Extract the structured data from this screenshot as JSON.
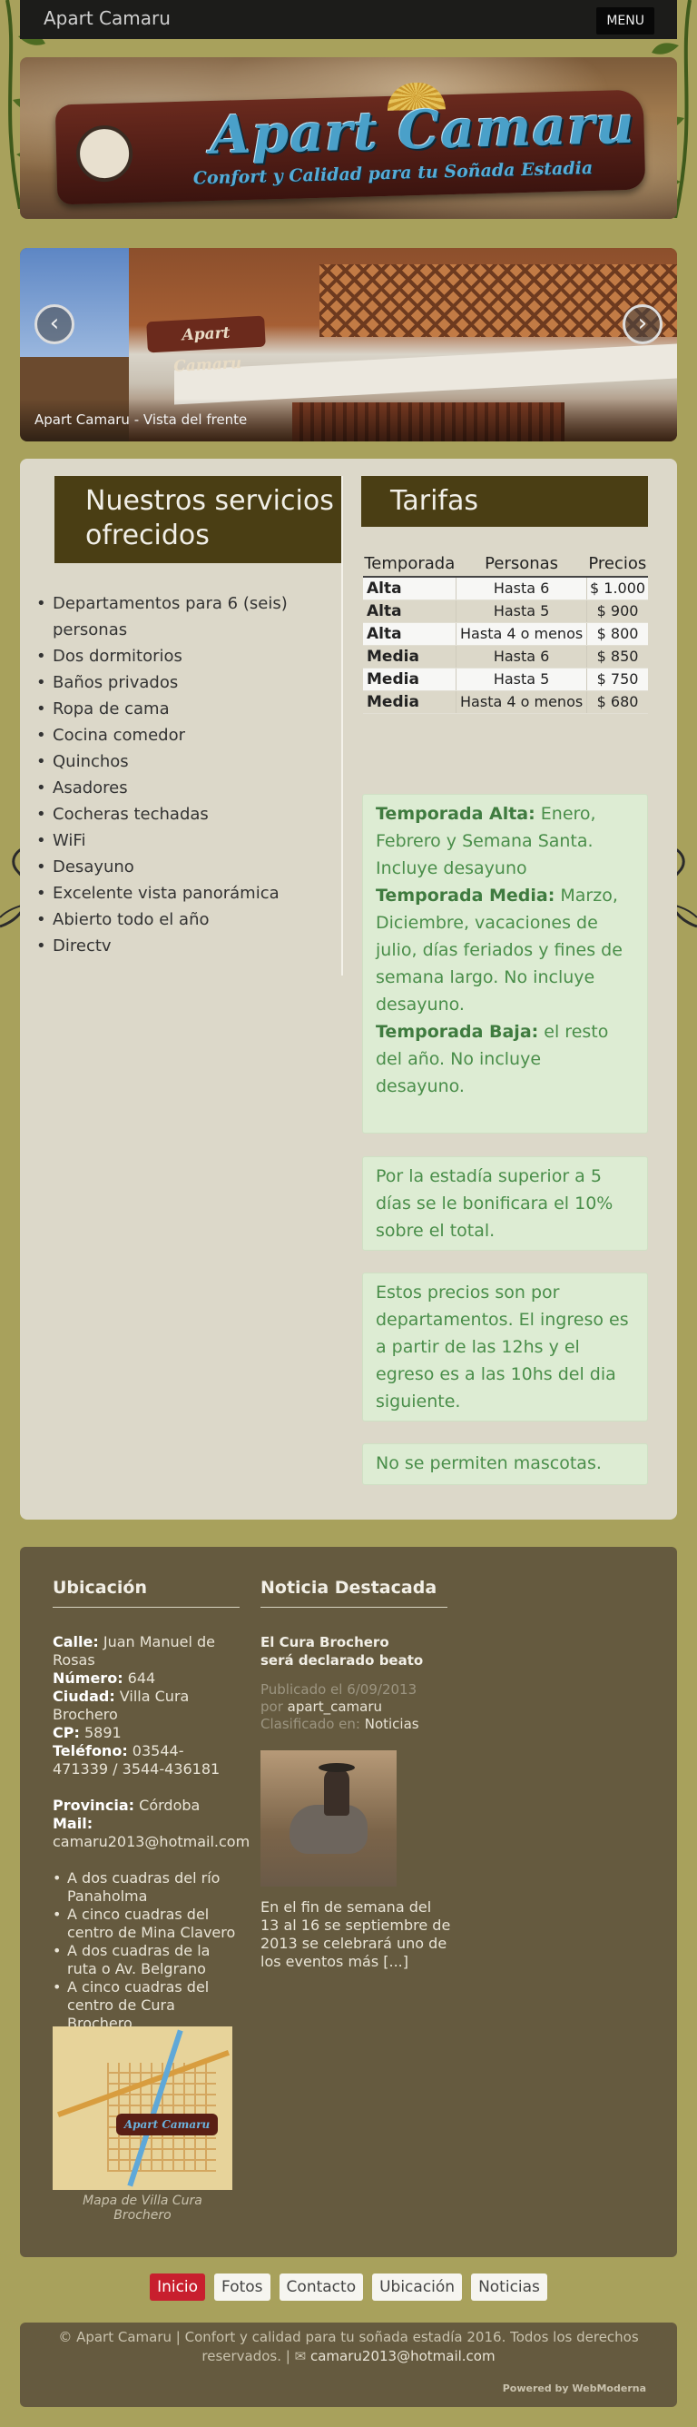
{
  "header": {
    "site_title": "Apart Camaru",
    "menu_label": "MENU"
  },
  "banner": {
    "sign_title": "Apart Camaru",
    "sign_subtitle": "Confort y Calidad para tu Soñada Estadia"
  },
  "slider": {
    "caption": "Apart Camaru - Vista del frente",
    "prev_icon": "chevron-left-icon",
    "next_icon": "chevron-right-icon",
    "sign_text": "Apart Camaru"
  },
  "services": {
    "heading": "Nuestros servicios ofrecidos",
    "items": [
      "Departamentos para 6 (seis) personas",
      "Dos dormitorios",
      "Baños privados",
      "Ropa de cama",
      "Cocina comedor",
      "Quinchos",
      "Asadores",
      "Cocheras techadas",
      "WiFi",
      "Desayuno",
      "Excelente vista panorámica",
      "Abierto todo el año",
      "Directv"
    ]
  },
  "tarifas": {
    "heading": "Tarifas",
    "columns": [
      "Temporada",
      "Personas",
      "Precios"
    ],
    "rows": [
      {
        "temporada": "Alta",
        "personas": "Hasta 6",
        "precio": "$ 1.000"
      },
      {
        "temporada": "Alta",
        "personas": "Hasta 5",
        "precio": "$ 900"
      },
      {
        "temporada": "Alta",
        "personas": "Hasta 4 o menos",
        "precio": "$ 800"
      },
      {
        "temporada": "Media",
        "personas": "Hasta 6",
        "precio": "$ 850"
      },
      {
        "temporada": "Media",
        "personas": "Hasta 5",
        "precio": "$ 750"
      },
      {
        "temporada": "Media",
        "personas": "Hasta 4 o menos",
        "precio": "$ 680"
      }
    ],
    "seasons_note": {
      "alta_label": "Temporada Alta:",
      "alta_text": " Enero, Febrero y Semana Santa. Incluye desayuno",
      "media_label": "Temporada Media:",
      "media_text": " Marzo, Diciembre, vacaciones de julio, días feriados y fines de semana largo. No incluye desayuno.",
      "baja_label": "Temporada Baja:",
      "baja_text": " el resto del año.  No incluye desayuno."
    },
    "bonus_note": "Por la estadía superior a 5 días se le bonificara el 10% sobre el  total.",
    "price_note": "Estos precios son por departamentos. El ingreso es a partir de las 12hs y el egreso es a las 10hs del dia siguiente.",
    "pets_note": "No se permiten mascotas."
  },
  "location": {
    "heading": "Ubicación",
    "calle_label": "Calle:",
    "calle": " Juan Manuel de Rosas",
    "numero_label": "Número:",
    "numero": " 644",
    "ciudad_label": "Ciudad:",
    "ciudad": " Villa Cura Brochero",
    "cp_label": "CP:",
    "cp": " 5891",
    "telefono_label": "Teléfono:",
    "telefono": " 03544-471339 / 3544-436181",
    "provincia_label": "Provincia:",
    "provincia": " Córdoba",
    "mail_label": "Mail:",
    "mail": "camaru2013@hotmail.com",
    "nearby": [
      "A dos cuadras del río Panaholma",
      "A cinco cuadras del centro de Mina Clavero",
      "A dos cuadras de la ruta o Av. Belgrano",
      "A cinco cuadras del centro de Cura Brochero"
    ],
    "map_caption": "Mapa de Villa Cura Brochero",
    "map_logo": "Apart Camaru"
  },
  "news": {
    "heading": "Noticia Destacada",
    "title": "El Cura Brochero será declarado beato",
    "published_prefix": "Publicado el 6/09/2013",
    "by_prefix": "por ",
    "author": "apart_camaru",
    "classified_prefix": "Clasificado en: ",
    "category": "Noticias",
    "excerpt": "En el fin de semana del 13 al 16 se septiembre de 2013 se celebrará uno de los eventos más [...]"
  },
  "nav": {
    "items": [
      "Inicio",
      "Fotos",
      "Contacto",
      "Ubicación",
      "Noticias"
    ]
  },
  "footer": {
    "copyright": "© Apart Camaru | Confort y calidad para tu soñada estadía 2016. Todos los derechos reservados. |",
    "mail_icon": "envelope-icon",
    "mail": "camaru2013@hotmail.com",
    "powered": "Powered by WebModerna"
  },
  "colors": {
    "page_bg": "#a8a15c",
    "heading_bg": "#4a3e14",
    "footer_bg": "#655a3f",
    "note_bg": "#ddecd3",
    "note_text": "#4a8e4a",
    "active_nav": "#c81f2e"
  }
}
